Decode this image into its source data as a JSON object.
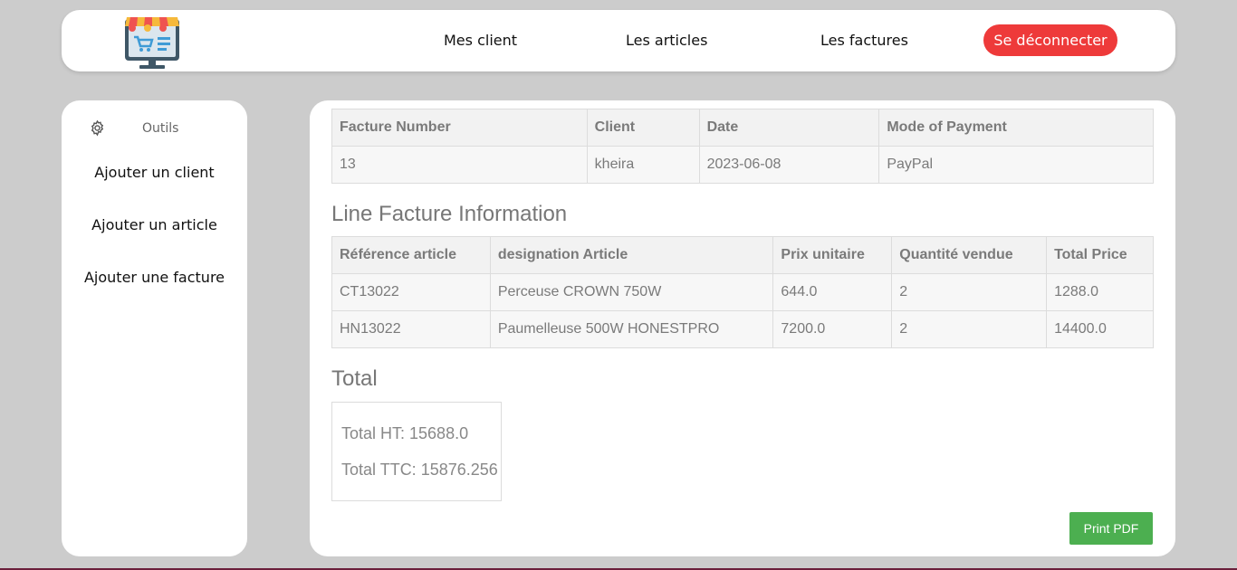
{
  "nav": {
    "links": [
      "Mes client",
      "Les articles",
      "Les factures"
    ],
    "logout": "Se déconnecter"
  },
  "sidebar": {
    "tools_label": "Outils",
    "gear_icon": "gear-icon",
    "links": [
      "Ajouter un client",
      "Ajouter un article",
      "Ajouter une facture"
    ]
  },
  "invoice": {
    "headers": [
      "Facture Number",
      "Client",
      "Date",
      "Mode of Payment"
    ],
    "row": [
      "13",
      "kheira",
      "2023-06-08",
      "PayPal"
    ]
  },
  "lines": {
    "title": "Line Facture Information",
    "headers": [
      "Référence article",
      "designation Article",
      "Prix unitaire",
      "Quantité vendue",
      "Total Price"
    ],
    "rows": [
      [
        "CT13022",
        "Perceuse CROWN 750W",
        "644.0",
        "2",
        "1288.0"
      ],
      [
        "HN13022",
        "Paumelleuse 500W HONESTPRO",
        "7200.0",
        "2",
        "14400.0"
      ]
    ]
  },
  "totals": {
    "title": "Total",
    "ht": "Total HT: 15688.0",
    "ttc": "Total TTC: 15876.256"
  },
  "print_button": "Print PDF",
  "colors": {
    "logout": "#ee3a3a",
    "print": "#4caf50",
    "background": "#cccccc"
  }
}
